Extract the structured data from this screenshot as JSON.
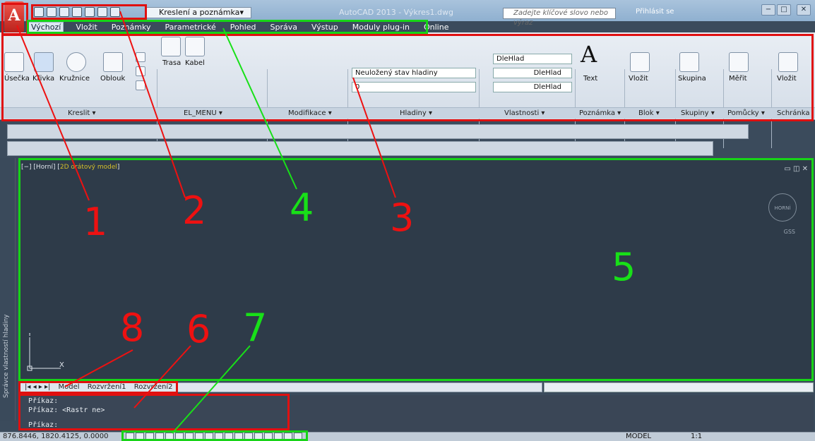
{
  "colors": {
    "red_marker": "#e01010",
    "green_marker": "#17d417",
    "drawing_bg": "#2e3b49"
  },
  "title_bar": {
    "workspace": "Kreslení a poznámka",
    "app_title": "AutoCAD 2013 - Výkres1.dwg",
    "search_placeholder": "Zadejte klíčové slovo nebo výraz",
    "login": "Přihlásit se"
  },
  "ribbon_tabs": [
    "Výchozí",
    "Vložit",
    "Poznámky",
    "Parametrické",
    "Pohled",
    "Správa",
    "Výstup",
    "Moduly plug-in",
    "Online"
  ],
  "ribbon": {
    "kreslit": {
      "label": "Kreslit ▾",
      "tools": [
        "Úsečka",
        "Křivka",
        "Kružnice",
        "Oblouk"
      ]
    },
    "elmenu": {
      "label": "EL_MENU ▾",
      "tools": [
        "Trasa",
        "Kabel"
      ]
    },
    "modifikace": {
      "label": "Modifikace ▾"
    },
    "hladiny": {
      "label": "Hladiny ▾",
      "state": "Neuložený stav hladiny",
      "layer": "0"
    },
    "vlastnosti": {
      "label": "Vlastnosti ▾",
      "color": "DleHlad",
      "linetype": "DleHlad",
      "lineweight": "DleHlad"
    },
    "poznamka": {
      "label": "Poznámka ▾",
      "tool": "Text"
    },
    "blok": {
      "label": "Blok ▾",
      "tool": "Vložit"
    },
    "skupiny": {
      "label": "Skupiny ▾",
      "tool": "Skupina"
    },
    "pomucky": {
      "label": "Pomůcky ▾",
      "tool": "Měřit"
    },
    "schranka": {
      "label": "Schránka",
      "tool": "Vložit"
    }
  },
  "viewport": {
    "label_bracket": "[−] [Horní] [",
    "label_style": "2D drátový model",
    "label_end": "]",
    "cube_label": "HORNÍ",
    "gss": "GSS"
  },
  "palette": "Správce vlastností hladiny",
  "layout_tabs": [
    "Model",
    "Rozvržení1",
    "Rozvržení2"
  ],
  "command_lines": [
    "Příkaz:",
    "Příkaz:  <Rastr ne>",
    "",
    "Příkaz:"
  ],
  "status": {
    "coords": "876.8446, 1820.4125, 0.0000",
    "model": "MODEL",
    "scale": "1:1"
  },
  "annotations": [
    "1",
    "2",
    "3",
    "4",
    "5",
    "6",
    "7",
    "8"
  ]
}
